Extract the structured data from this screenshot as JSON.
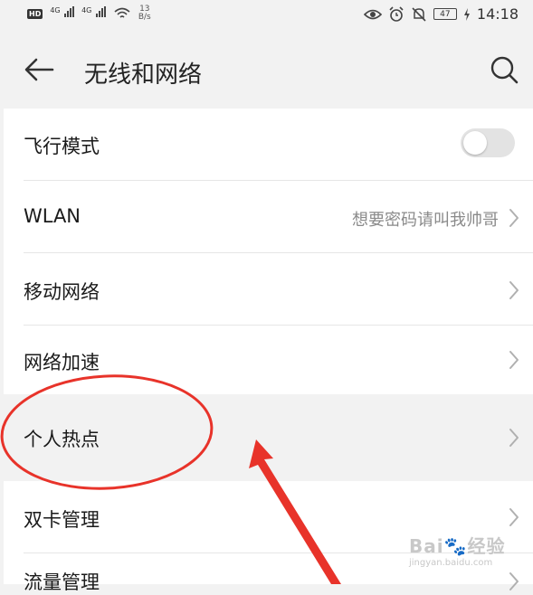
{
  "status_bar": {
    "hd_badge": "HD",
    "network_1": "4G",
    "network_2": "4G",
    "speed_value": "13",
    "speed_unit": "B/s",
    "battery": "47",
    "time": "14:18"
  },
  "header": {
    "title": "无线和网络"
  },
  "settings": {
    "airplane_mode": {
      "label": "飞行模式",
      "enabled": false
    },
    "wlan": {
      "label": "WLAN",
      "value": "想要密码请叫我帅哥"
    },
    "mobile_network": {
      "label": "移动网络"
    },
    "network_acceleration": {
      "label": "网络加速"
    },
    "personal_hotspot": {
      "label": "个人热点"
    },
    "dual_sim": {
      "label": "双卡管理"
    },
    "data_usage": {
      "label": "流量管理"
    }
  },
  "watermark": {
    "main": "Bai",
    "main_suffix": "经验",
    "sub": "jingyan.baidu.com"
  },
  "colors": {
    "annotation_red": "#e8332a",
    "background": "#f2f2f2",
    "list_background": "#ffffff"
  }
}
